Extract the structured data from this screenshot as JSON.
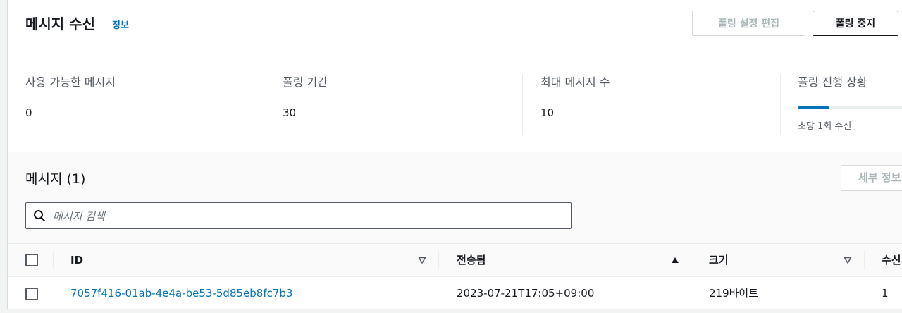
{
  "header": {
    "title": "메시지 수신",
    "info_link": "정보",
    "edit_button": "폴링 설정 편집",
    "stop_button": "폴링 중지"
  },
  "stats": [
    {
      "label": "사용 가능한 메시지",
      "value": "0"
    },
    {
      "label": "폴링 기간",
      "value": "30"
    },
    {
      "label": "최대 메시지 수",
      "value": "10"
    }
  ],
  "polling": {
    "label": "폴링 진행 상황",
    "progress_percent": 28,
    "subtext": "초당 1회 수신",
    "accent_color": "#0073bb"
  },
  "messages": {
    "title": "메시지 (1)",
    "detail_button": "세부 정보",
    "search_placeholder": "메시지 검색",
    "columns": [
      "ID",
      "전송됨",
      "크기",
      "수신"
    ],
    "column_icons": [
      "sort-down-icon",
      "sort-up-icon",
      "sort-down-icon"
    ],
    "rows": [
      {
        "id": "7057f416-01ab-4e4a-be53-5d85eb8fc7b3",
        "sent": "2023-07-21T17:05+09:00",
        "size": "219바이트",
        "received": "1"
      }
    ]
  }
}
